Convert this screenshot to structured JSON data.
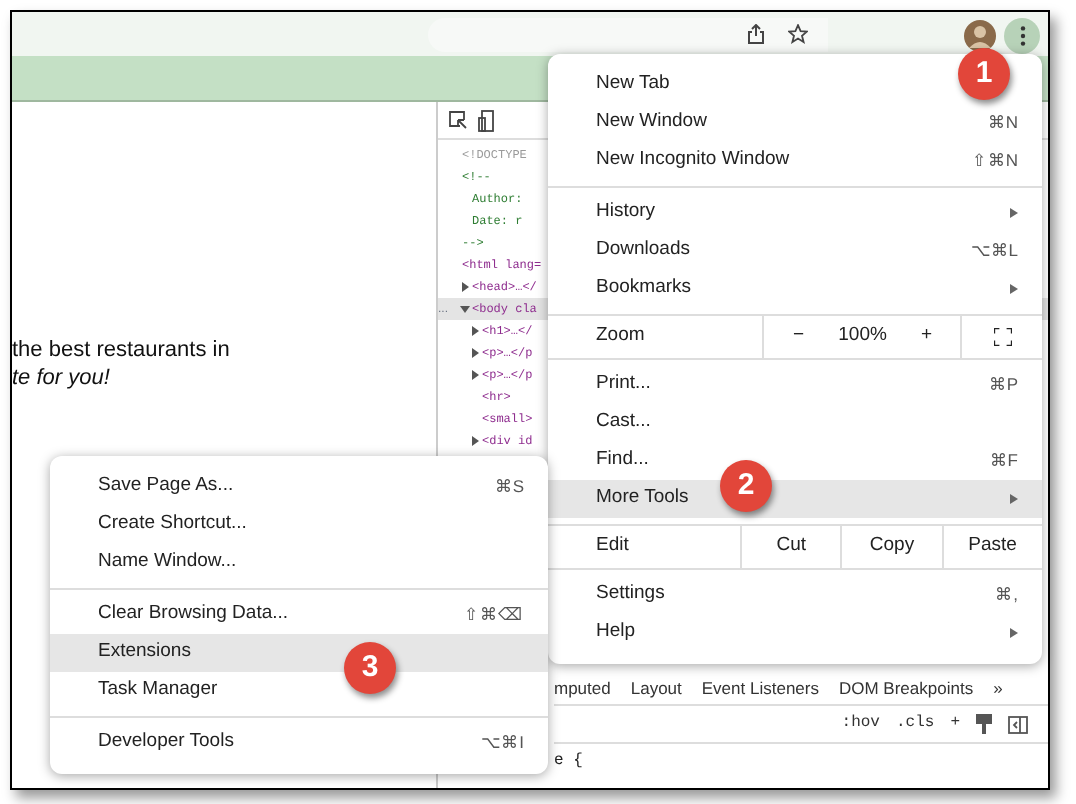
{
  "page": {
    "lines": [
      {
        "text": "the best restaurants in",
        "italic": false
      },
      {
        "text": "te for you!",
        "italic": true
      }
    ]
  },
  "devtools": {
    "tree": [
      {
        "text": "<!DOCTYPE",
        "kind": "doctype",
        "selected": false
      },
      {
        "text": "<!--",
        "kind": "comment",
        "selected": false,
        "children": [
          {
            "text": "Author:",
            "kind": "comment",
            "selected": false
          },
          {
            "text": "Date: r",
            "kind": "comment",
            "selected": false
          }
        ]
      },
      {
        "text": "-->",
        "kind": "comment",
        "selected": false
      },
      {
        "text": "<html lang=",
        "kind": "tag",
        "selected": false,
        "children": [
          {
            "text": "<head>…</",
            "kind": "tag",
            "selected": false,
            "expanded": false
          },
          {
            "text": "<body cla",
            "kind": "tag",
            "selected": true,
            "expanded": true,
            "children": [
              {
                "text": "<h1>…</",
                "kind": "tag",
                "selected": false,
                "expanded": false
              },
              {
                "text": "<p>…</p",
                "kind": "tag",
                "selected": false,
                "expanded": false
              },
              {
                "text": "<p>…</p",
                "kind": "tag",
                "selected": false,
                "expanded": false
              },
              {
                "text": "<hr>",
                "kind": "tag",
                "selected": false
              },
              {
                "text": "<small>",
                "kind": "tag",
                "selected": false
              },
              {
                "text": "<div id",
                "kind": "tag",
                "selected": false,
                "expanded": false
              }
            ]
          }
        ]
      }
    ],
    "selected_prefix": "...",
    "styles_tabs": [
      {
        "label": "mputed"
      },
      {
        "label": "Layout"
      },
      {
        "label": "Event Listeners"
      },
      {
        "label": "DOM Breakpoints"
      },
      {
        "label": "»"
      }
    ],
    "filter_buttons": [
      ":hov",
      ".cls",
      "+"
    ],
    "rule_text": "e {"
  },
  "menu": {
    "sections": [
      [
        {
          "kind": "item",
          "label": "New Tab",
          "submenu": false,
          "selected": false
        },
        {
          "kind": "item",
          "label": "New Window",
          "shortcut": "⌘N",
          "submenu": false,
          "selected": false
        },
        {
          "kind": "item",
          "label": "New Incognito Window",
          "shortcut": "⇧⌘N",
          "submenu": false,
          "selected": false
        }
      ],
      [
        {
          "kind": "item",
          "label": "History",
          "submenu": true,
          "selected": false
        },
        {
          "kind": "item",
          "label": "Downloads",
          "shortcut": "⌥⌘L",
          "submenu": false,
          "selected": false
        },
        {
          "kind": "item",
          "label": "Bookmarks",
          "submenu": true,
          "selected": false
        }
      ],
      [
        {
          "kind": "zoom",
          "label": "Zoom",
          "minus": "−",
          "value": "100%",
          "plus": "+"
        }
      ],
      [
        {
          "kind": "item",
          "label": "Print...",
          "shortcut": "⌘P",
          "submenu": false,
          "selected": false
        },
        {
          "kind": "item",
          "label": "Cast...",
          "submenu": false,
          "selected": false
        },
        {
          "kind": "item",
          "label": "Find...",
          "shortcut": "⌘F",
          "submenu": false,
          "selected": false
        },
        {
          "kind": "item",
          "label": "More Tools",
          "submenu": true,
          "selected": true
        }
      ],
      [
        {
          "kind": "edit",
          "label": "Edit",
          "buttons": [
            "Cut",
            "Copy",
            "Paste"
          ]
        }
      ],
      [
        {
          "kind": "item",
          "label": "Settings",
          "shortcut": "⌘,",
          "submenu": false,
          "selected": false
        },
        {
          "kind": "item",
          "label": "Help",
          "submenu": true,
          "selected": false
        }
      ]
    ]
  },
  "submenu": {
    "sections": [
      [
        {
          "label": "Save Page As...",
          "shortcut": "⌘S",
          "selected": false
        },
        {
          "label": "Create Shortcut...",
          "selected": false
        },
        {
          "label": "Name Window...",
          "selected": false
        }
      ],
      [
        {
          "label": "Clear Browsing Data...",
          "shortcut": "⇧⌘⌫",
          "selected": false
        },
        {
          "label": "Extensions",
          "selected": true
        },
        {
          "label": "Task Manager",
          "selected": false
        }
      ],
      [
        {
          "label": "Developer Tools",
          "shortcut": "⌥⌘I",
          "selected": false
        }
      ]
    ]
  },
  "callouts": [
    {
      "number": "1"
    },
    {
      "number": "2"
    },
    {
      "number": "3"
    }
  ]
}
